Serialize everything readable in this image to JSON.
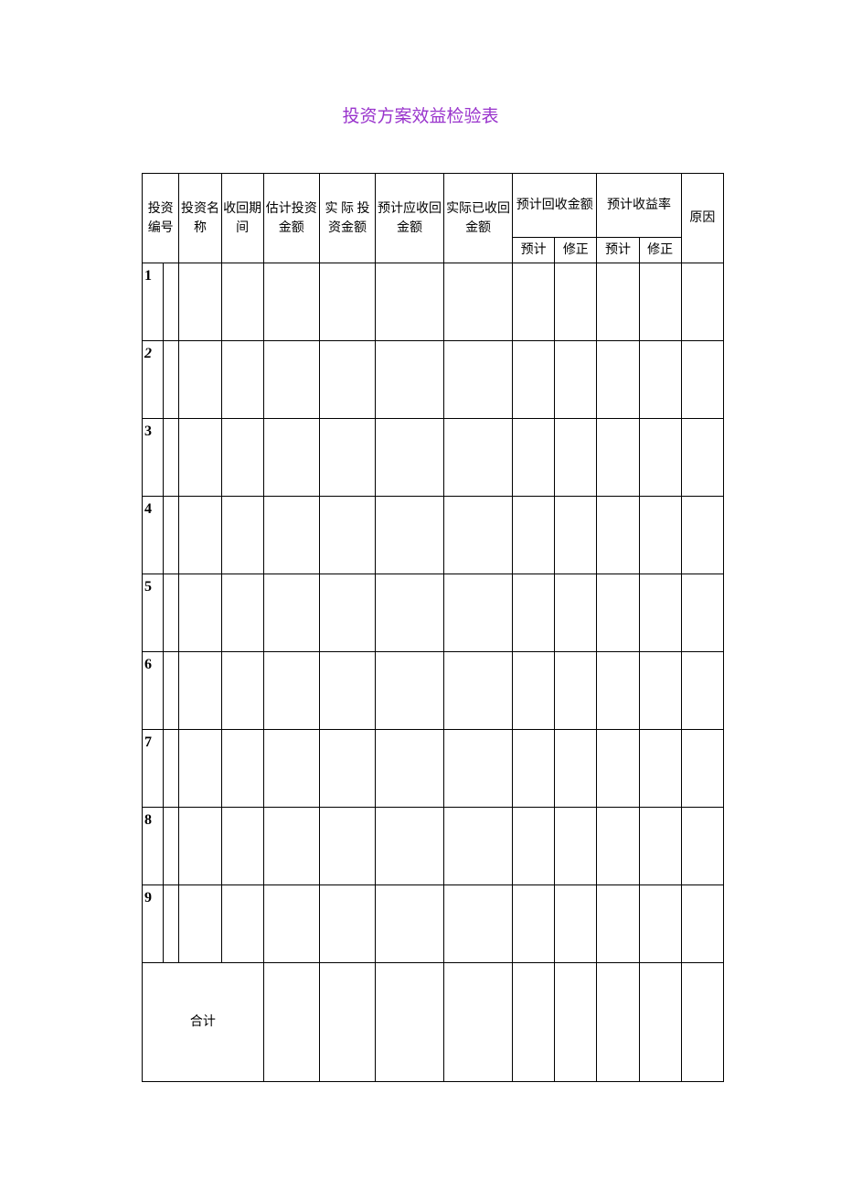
{
  "title": "投资方案效益检验表",
  "headers": {
    "invest_number": "投资编号",
    "invest_name": "投资名称",
    "recovery_period": "收回期间",
    "estimated_investment": "估计投资金额",
    "actual_investment": "实 际 投资金额",
    "expected_recovery": "预计应收回金额",
    "actual_recovery": "实际已收回金额",
    "expected_recovery_amount": "预计回收金额",
    "expected_yield_rate": "预计收益率",
    "reason": "原因",
    "sub_expected": "预计",
    "sub_revised": "修正"
  },
  "row_numbers": [
    "1",
    "2",
    "3",
    "4",
    "5",
    "6",
    "7",
    "8",
    "9"
  ],
  "total_label": "合计"
}
